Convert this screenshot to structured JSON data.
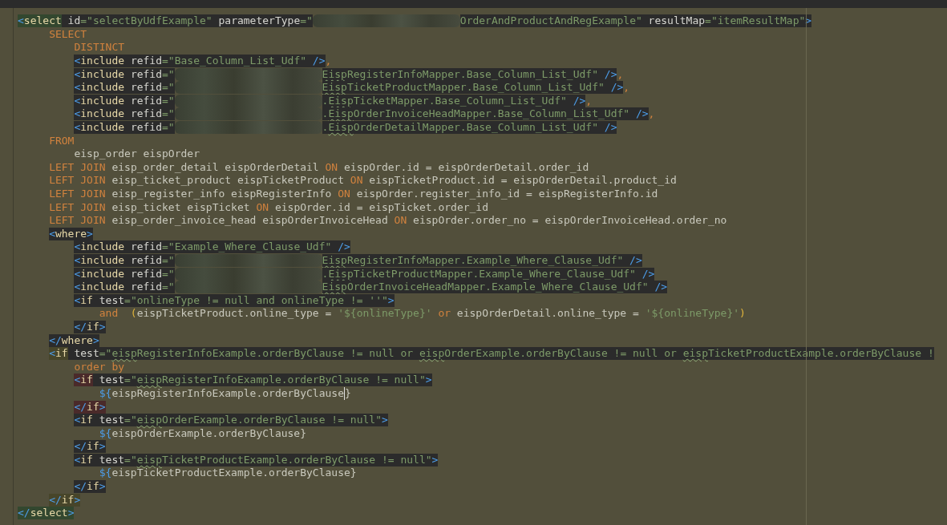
{
  "editor": {
    "lines": [
      {
        "tokens": [
          {
            "kind": "bracket",
            "text": "<",
            "color": "#33472f"
          },
          {
            "kind": "tag",
            "text": "select",
            "color": "#33472f"
          },
          {
            "kind": "attribute",
            "text": " id",
            "color": "#2b2b2b"
          },
          {
            "kind": "string",
            "text": "=\"selectByUdfExample\"",
            "color": "#2b2b2b"
          },
          {
            "kind": "attribute",
            "text": " parameterType",
            "color": "#2b2b2b"
          },
          {
            "kind": "string",
            "text": "=\"",
            "color": "#2b2b2b"
          },
          {
            "kind": "redacted"
          },
          {
            "kind": "string",
            "text": "OrderAndProductAndRegExample\"",
            "color": "#2b2b2b"
          },
          {
            "kind": "attribute",
            "text": " resultMap",
            "color": "#2b2b2b"
          },
          {
            "kind": "string",
            "text": "=\"itemResultMap\"",
            "color": "#2b2b2b"
          },
          {
            "kind": "bracket",
            "text": ">",
            "color": "#2b2b2b"
          }
        ],
        "children": [
          {
            "tokens": [
              {
                "kind": "keyword",
                "text": "SELECT"
              }
            ],
            "children": [
              {
                "tokens": [
                  {
                    "kind": "keyword",
                    "text": "DISTINCT"
                  }
                ]
              },
              {
                "tokens": [
                  {
                    "kind": "bracket",
                    "text": "<",
                    "color": "#2b2b2b"
                  },
                  {
                    "kind": "tag",
                    "text": "include",
                    "color": "#2b2b2b"
                  },
                  {
                    "kind": "attribute",
                    "text": " refid",
                    "color": "#2b2b2b"
                  },
                  {
                    "kind": "string",
                    "text": "=\"Base_Column_List_Udf\"",
                    "color": "#2b2b2b"
                  },
                  {
                    "kind": "bracket",
                    "text": " />",
                    "color": "#2b2b2b"
                  },
                  {
                    "kind": "comma",
                    "text": ","
                  }
                ]
              },
              {
                "tokens": [
                  {
                    "kind": "bracket",
                    "text": "<",
                    "color": "#2b2b2b"
                  },
                  {
                    "kind": "tag",
                    "text": "include",
                    "color": "#2b2b2b"
                  },
                  {
                    "kind": "attribute",
                    "text": " refid",
                    "color": "#2b2b2b"
                  },
                  {
                    "kind": "string",
                    "text": "=\"",
                    "color": "#2b2b2b"
                  },
                  {
                    "kind": "redacted"
                  },
                  {
                    "kind": "string",
                    "text": "Eisp",
                    "color": "#2b2b2b",
                    "typo": true
                  },
                  {
                    "kind": "string",
                    "text": "RegisterInfoMapper.Base_Column_List_Udf\"",
                    "color": "#2b2b2b"
                  },
                  {
                    "kind": "bracket",
                    "text": " />",
                    "color": "#2b2b2b"
                  },
                  {
                    "kind": "comma",
                    "text": ","
                  }
                ]
              },
              {
                "tokens": [
                  {
                    "kind": "bracket",
                    "text": "<",
                    "color": "#2b2b2b"
                  },
                  {
                    "kind": "tag",
                    "text": "include",
                    "color": "#2b2b2b"
                  },
                  {
                    "kind": "attribute",
                    "text": " refid",
                    "color": "#2b2b2b"
                  },
                  {
                    "kind": "string",
                    "text": "=\"",
                    "color": "#2b2b2b"
                  },
                  {
                    "kind": "redacted"
                  },
                  {
                    "kind": "string",
                    "text": "Eisp",
                    "color": "#2b2b2b",
                    "typo": true
                  },
                  {
                    "kind": "string",
                    "text": "TicketProductMapper.Base_Column_List_Udf\"",
                    "color": "#2b2b2b"
                  },
                  {
                    "kind": "bracket",
                    "text": " />",
                    "color": "#2b2b2b"
                  },
                  {
                    "kind": "comma",
                    "text": ","
                  }
                ]
              },
              {
                "tokens": [
                  {
                    "kind": "bracket",
                    "text": "<",
                    "color": "#2b2b2b"
                  },
                  {
                    "kind": "tag",
                    "text": "include",
                    "color": "#2b2b2b"
                  },
                  {
                    "kind": "attribute",
                    "text": " refid",
                    "color": "#2b2b2b"
                  },
                  {
                    "kind": "string",
                    "text": "=\"",
                    "color": "#2b2b2b"
                  },
                  {
                    "kind": "redacted"
                  },
                  {
                    "kind": "string",
                    "text": ".",
                    "color": "#2b2b2b"
                  },
                  {
                    "kind": "string",
                    "text": "Eisp",
                    "color": "#2b2b2b",
                    "typo": true
                  },
                  {
                    "kind": "string",
                    "text": "TicketMapper.Base_Column_List_Udf\"",
                    "color": "#2b2b2b"
                  },
                  {
                    "kind": "bracket",
                    "text": " />",
                    "color": "#2b2b2b"
                  },
                  {
                    "kind": "comma",
                    "text": ","
                  }
                ]
              },
              {
                "tokens": [
                  {
                    "kind": "bracket",
                    "text": "<",
                    "color": "#2b2b2b"
                  },
                  {
                    "kind": "tag",
                    "text": "include",
                    "color": "#2b2b2b"
                  },
                  {
                    "kind": "attribute",
                    "text": " refid",
                    "color": "#2b2b2b"
                  },
                  {
                    "kind": "string",
                    "text": "=\"",
                    "color": "#2b2b2b"
                  },
                  {
                    "kind": "redacted"
                  },
                  {
                    "kind": "string",
                    "text": ".",
                    "color": "#2b2b2b"
                  },
                  {
                    "kind": "string",
                    "text": "Eisp",
                    "color": "#2b2b2b",
                    "typo": true
                  },
                  {
                    "kind": "string",
                    "text": "OrderInvoiceHeadMapper.Base_Column_List_Udf\"",
                    "color": "#2b2b2b"
                  },
                  {
                    "kind": "bracket",
                    "text": " />",
                    "color": "#2b2b2b"
                  },
                  {
                    "kind": "comma",
                    "text": ","
                  }
                ]
              },
              {
                "tokens": [
                  {
                    "kind": "bracket",
                    "text": "<",
                    "color": "#2b2b2b"
                  },
                  {
                    "kind": "tag",
                    "text": "include",
                    "color": "#2b2b2b"
                  },
                  {
                    "kind": "attribute",
                    "text": " refid",
                    "color": "#2b2b2b"
                  },
                  {
                    "kind": "string",
                    "text": "=\"",
                    "color": "#2b2b2b"
                  },
                  {
                    "kind": "redacted"
                  },
                  {
                    "kind": "string",
                    "text": ".",
                    "color": "#2b2b2b"
                  },
                  {
                    "kind": "string",
                    "text": "Eisp",
                    "color": "#2b2b2b",
                    "typo": true
                  },
                  {
                    "kind": "string",
                    "text": "OrderDetailMapper.Base_Column_List_Udf\"",
                    "color": "#2b2b2b"
                  },
                  {
                    "kind": "bracket",
                    "text": " />",
                    "color": "#2b2b2b"
                  }
                ]
              }
            ]
          },
          {
            "tokens": [
              {
                "kind": "keyword",
                "text": "FROM"
              }
            ],
            "children": [
              {
                "tokens": [
                  {
                    "kind": "plain",
                    "text": "eisp_order eispOrder"
                  }
                ]
              }
            ]
          },
          {
            "tokens": [
              {
                "kind": "keyword",
                "text": "LEFT JOIN"
              },
              {
                "kind": "plain",
                "text": " eisp_order_detail eispOrderDetail "
              },
              {
                "kind": "keyword",
                "text": "ON"
              },
              {
                "kind": "plain",
                "text": " eispOrder.id = eispOrderDetail.order_id"
              }
            ]
          },
          {
            "tokens": [
              {
                "kind": "keyword",
                "text": "LEFT JOIN"
              },
              {
                "kind": "plain",
                "text": " eisp_ticket_product eispTicketProduct "
              },
              {
                "kind": "keyword",
                "text": "ON"
              },
              {
                "kind": "plain",
                "text": " eispTicketProduct.id = eispOrderDetail.product_id"
              }
            ]
          },
          {
            "tokens": [
              {
                "kind": "keyword",
                "text": "LEFT JOIN"
              },
              {
                "kind": "plain",
                "text": " eisp_register_info eispRegisterInfo "
              },
              {
                "kind": "keyword",
                "text": "ON"
              },
              {
                "kind": "plain",
                "text": " eispOrder.register_info_id = eispRegisterInfo.id"
              }
            ]
          },
          {
            "tokens": [
              {
                "kind": "keyword",
                "text": "LEFT JOIN"
              },
              {
                "kind": "plain",
                "text": " eisp_ticket eispTicket "
              },
              {
                "kind": "keyword",
                "text": "ON"
              },
              {
                "kind": "plain",
                "text": " eispOrder.id = eispTicket.order_id"
              }
            ]
          },
          {
            "tokens": [
              {
                "kind": "keyword",
                "text": "LEFT JOIN"
              },
              {
                "kind": "plain",
                "text": " eisp_order_invoice_head eispOrderInvoiceHead "
              },
              {
                "kind": "keyword",
                "text": "ON"
              },
              {
                "kind": "plain",
                "text": " eispOrder.order_no = eispOrderInvoiceHead.order_no"
              }
            ]
          },
          {
            "tokens": [
              {
                "kind": "bracket",
                "text": "<",
                "color": "#2b2b2b"
              },
              {
                "kind": "tag",
                "text": "where",
                "color": "#2b2b2b"
              },
              {
                "kind": "bracket",
                "text": ">",
                "color": "#2b2b2b"
              }
            ],
            "children": [
              {
                "tokens": [
                  {
                    "kind": "bracket",
                    "text": "<",
                    "color": "#2b2b2b"
                  },
                  {
                    "kind": "tag",
                    "text": "include",
                    "color": "#2b2b2b"
                  },
                  {
                    "kind": "attribute",
                    "text": " refid",
                    "color": "#2b2b2b"
                  },
                  {
                    "kind": "string",
                    "text": "=\"Example_Where_Clause_Udf\"",
                    "color": "#2b2b2b"
                  },
                  {
                    "kind": "bracket",
                    "text": " />",
                    "color": "#2b2b2b"
                  }
                ]
              },
              {
                "tokens": [
                  {
                    "kind": "bracket",
                    "text": "<",
                    "color": "#2b2b2b"
                  },
                  {
                    "kind": "tag",
                    "text": "include",
                    "color": "#2b2b2b"
                  },
                  {
                    "kind": "attribute",
                    "text": " refid",
                    "color": "#2b2b2b"
                  },
                  {
                    "kind": "string",
                    "text": "=\"",
                    "color": "#2b2b2b"
                  },
                  {
                    "kind": "redacted"
                  },
                  {
                    "kind": "string",
                    "text": "Eisp",
                    "color": "#2b2b2b",
                    "typo": true
                  },
                  {
                    "kind": "string",
                    "text": "RegisterInfoMapper.Example_Where_Clause_Udf\"",
                    "color": "#2b2b2b"
                  },
                  {
                    "kind": "bracket",
                    "text": " />",
                    "color": "#2b2b2b"
                  }
                ]
              },
              {
                "tokens": [
                  {
                    "kind": "bracket",
                    "text": "<",
                    "color": "#2b2b2b"
                  },
                  {
                    "kind": "tag",
                    "text": "include",
                    "color": "#2b2b2b"
                  },
                  {
                    "kind": "attribute",
                    "text": " refid",
                    "color": "#2b2b2b"
                  },
                  {
                    "kind": "string",
                    "text": "=\"",
                    "color": "#2b2b2b"
                  },
                  {
                    "kind": "redacted"
                  },
                  {
                    "kind": "string",
                    "text": ".",
                    "color": "#2b2b2b"
                  },
                  {
                    "kind": "string",
                    "text": "Eisp",
                    "color": "#2b2b2b",
                    "typo": true
                  },
                  {
                    "kind": "string",
                    "text": "TicketProductMapper.Example_Where_Clause_Udf\"",
                    "color": "#2b2b2b"
                  },
                  {
                    "kind": "bracket",
                    "text": " />",
                    "color": "#2b2b2b"
                  }
                ]
              },
              {
                "tokens": [
                  {
                    "kind": "bracket",
                    "text": "<",
                    "color": "#2b2b2b"
                  },
                  {
                    "kind": "tag",
                    "text": "include",
                    "color": "#2b2b2b"
                  },
                  {
                    "kind": "attribute",
                    "text": " refid",
                    "color": "#2b2b2b"
                  },
                  {
                    "kind": "string",
                    "text": "=\"",
                    "color": "#2b2b2b"
                  },
                  {
                    "kind": "redacted"
                  },
                  {
                    "kind": "string",
                    "text": "Eisp",
                    "color": "#2b2b2b",
                    "typo": true
                  },
                  {
                    "kind": "string",
                    "text": "OrderInvoiceHeadMapper.Example_Where_Clause_Udf\"",
                    "color": "#2b2b2b"
                  },
                  {
                    "kind": "bracket",
                    "text": " />",
                    "color": "#2b2b2b"
                  }
                ]
              },
              {
                "tokens": [
                  {
                    "kind": "bracket",
                    "text": "<",
                    "color": "#2b2b2b"
                  },
                  {
                    "kind": "tag",
                    "text": "if",
                    "color": "#2b2b2b"
                  },
                  {
                    "kind": "attribute",
                    "text": " test",
                    "color": "#2b2b2b"
                  },
                  {
                    "kind": "string",
                    "text": "=\"onlineType != null and onlineType != ''\"",
                    "color": "#2b2b2b"
                  },
                  {
                    "kind": "bracket",
                    "text": ">",
                    "color": "#2b2b2b"
                  }
                ],
                "children": [
                  {
                    "tokens": [
                      {
                        "kind": "keyword",
                        "text": "and"
                      },
                      {
                        "kind": "paren",
                        "text": "  ("
                      },
                      {
                        "kind": "plain",
                        "text": "eispTicketProduct.online_type = "
                      },
                      {
                        "kind": "string",
                        "text": "'${onlineType}'"
                      },
                      {
                        "kind": "keyword",
                        "text": " or"
                      },
                      {
                        "kind": "plain",
                        "text": " eispOrderDetail.online_type = "
                      },
                      {
                        "kind": "string",
                        "text": "'${onlineType}'"
                      },
                      {
                        "kind": "paren",
                        "text": ")"
                      }
                    ]
                  }
                ]
              },
              {
                "tokens": [
                  {
                    "kind": "bracket",
                    "text": "</",
                    "color": "#2b2b2b"
                  },
                  {
                    "kind": "tag",
                    "text": "if",
                    "color": "#2b2b2b"
                  },
                  {
                    "kind": "bracket",
                    "text": ">",
                    "color": "#2b2b2b"
                  }
                ]
              }
            ]
          },
          {
            "tokens": [
              {
                "kind": "bracket",
                "text": "</",
                "color": "#2b2b2b"
              },
              {
                "kind": "tag",
                "text": "where",
                "color": "#2b2b2b"
              },
              {
                "kind": "bracket",
                "text": ">",
                "color": "#2b2b2b"
              }
            ]
          },
          {
            "tokens": [
              {
                "kind": "bracket",
                "text": "<",
                "color": "#47452a"
              },
              {
                "kind": "tag",
                "text": "if",
                "color": "#47452a"
              },
              {
                "kind": "attribute",
                "text": " test",
                "color": "#2b2b2b"
              },
              {
                "kind": "string",
                "text": "=\"",
                "color": "#2b2b2b"
              },
              {
                "kind": "string",
                "text": "eisp",
                "color": "#2b2b2b",
                "typo": true
              },
              {
                "kind": "string",
                "text": "RegisterInfoExample.orderByClause != null or ",
                "color": "#2b2b2b"
              },
              {
                "kind": "string",
                "text": "eisp",
                "color": "#2b2b2b",
                "typo": true
              },
              {
                "kind": "string",
                "text": "OrderExample.orderByClause != null or ",
                "color": "#2b2b2b"
              },
              {
                "kind": "string",
                "text": "eisp",
                "color": "#2b2b2b",
                "typo": true
              },
              {
                "kind": "string",
                "text": "TicketProductExample.orderByClause !",
                "color": "#2b2b2b"
              }
            ],
            "children": [
              {
                "tokens": [
                  {
                    "kind": "keyword",
                    "text": "order by"
                  }
                ]
              },
              {
                "tokens": [
                  {
                    "kind": "bracket",
                    "text": "<",
                    "color": "#4a2a2a"
                  },
                  {
                    "kind": "tag",
                    "text": "if",
                    "color": "#4a2a2a"
                  },
                  {
                    "kind": "attribute",
                    "text": " test",
                    "color": "#2b2b2b"
                  },
                  {
                    "kind": "string",
                    "text": "=\"",
                    "color": "#2b2b2b"
                  },
                  {
                    "kind": "string",
                    "text": "eisp",
                    "color": "#2b2b2b",
                    "typo": true
                  },
                  {
                    "kind": "string",
                    "text": "RegisterInfoExample.orderByClause != null\"",
                    "color": "#2b2b2b"
                  },
                  {
                    "kind": "bracket",
                    "text": ">",
                    "color": "#2b2b2b"
                  }
                ],
                "children": [
                  {
                    "tokens": [
                      {
                        "kind": "interpolation",
                        "text": "${"
                      },
                      {
                        "kind": "plain",
                        "text": "eispRegisterInfoExample.orderByClause",
                        "caret": true
                      },
                      {
                        "kind": "plain",
                        "text": "}"
                      }
                    ]
                  }
                ]
              },
              {
                "tokens": [
                  {
                    "kind": "bracket",
                    "text": "</",
                    "color": "#4a2a2a"
                  },
                  {
                    "kind": "tag",
                    "text": "if",
                    "color": "#4a2a2a"
                  },
                  {
                    "kind": "bracket",
                    "text": ">",
                    "color": "#4a2a2a"
                  }
                ]
              },
              {
                "tokens": [
                  {
                    "kind": "bracket",
                    "text": "<",
                    "color": "#2b2b2b"
                  },
                  {
                    "kind": "tag",
                    "text": "if",
                    "color": "#2b2b2b"
                  },
                  {
                    "kind": "attribute",
                    "text": " test",
                    "color": "#2b2b2b"
                  },
                  {
                    "kind": "string",
                    "text": "=\"",
                    "color": "#2b2b2b"
                  },
                  {
                    "kind": "string",
                    "text": "eisp",
                    "color": "#2b2b2b",
                    "typo": true
                  },
                  {
                    "kind": "string",
                    "text": "OrderExample.orderByClause != null\"",
                    "color": "#2b2b2b"
                  },
                  {
                    "kind": "bracket",
                    "text": ">",
                    "color": "#2b2b2b"
                  }
                ],
                "children": [
                  {
                    "tokens": [
                      {
                        "kind": "interpolation",
                        "text": "${"
                      },
                      {
                        "kind": "plain",
                        "text": "eispOrderExample.orderByClause}"
                      }
                    ]
                  }
                ]
              },
              {
                "tokens": [
                  {
                    "kind": "bracket",
                    "text": "</",
                    "color": "#2b2b2b"
                  },
                  {
                    "kind": "tag",
                    "text": "if",
                    "color": "#2b2b2b"
                  },
                  {
                    "kind": "bracket",
                    "text": ">",
                    "color": "#2b2b2b"
                  }
                ]
              },
              {
                "tokens": [
                  {
                    "kind": "bracket",
                    "text": "<",
                    "color": "#2b2b2b"
                  },
                  {
                    "kind": "tag",
                    "text": "if",
                    "color": "#2b2b2b"
                  },
                  {
                    "kind": "attribute",
                    "text": " test",
                    "color": "#2b2b2b"
                  },
                  {
                    "kind": "string",
                    "text": "=\"",
                    "color": "#2b2b2b"
                  },
                  {
                    "kind": "string",
                    "text": "eisp",
                    "color": "#2b2b2b",
                    "typo": true
                  },
                  {
                    "kind": "string",
                    "text": "TicketProductExample.orderByClause != null\"",
                    "color": "#2b2b2b"
                  },
                  {
                    "kind": "bracket",
                    "text": ">",
                    "color": "#2b2b2b"
                  }
                ],
                "children": [
                  {
                    "tokens": [
                      {
                        "kind": "interpolation",
                        "text": "${"
                      },
                      {
                        "kind": "plain",
                        "text": "eispTicketProductExample.orderByClause}"
                      }
                    ]
                  }
                ]
              },
              {
                "tokens": [
                  {
                    "kind": "bracket",
                    "text": "</",
                    "color": "#2b2b2b"
                  },
                  {
                    "kind": "tag",
                    "text": "if",
                    "color": "#2b2b2b"
                  },
                  {
                    "kind": "bracket",
                    "text": ">",
                    "color": "#2b2b2b"
                  }
                ]
              }
            ]
          },
          {
            "tokens": [
              {
                "kind": "bracket",
                "text": "</",
                "color": "#47452a"
              },
              {
                "kind": "tag",
                "text": "if",
                "color": "#47452a"
              },
              {
                "kind": "bracket",
                "text": ">",
                "color": "#47452a"
              }
            ]
          }
        ]
      },
      {
        "tokens": [
          {
            "kind": "bracket",
            "text": "</",
            "color": "#33472f"
          },
          {
            "kind": "tag",
            "text": "select",
            "color": "#33472f"
          },
          {
            "kind": "bracket",
            "text": ">",
            "color": "#33472f"
          }
        ]
      }
    ]
  }
}
